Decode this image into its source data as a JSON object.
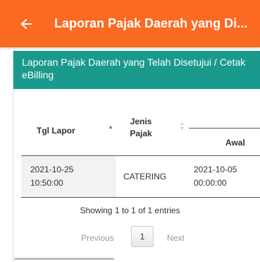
{
  "appbar": {
    "title": "Laporan Pajak Daerah yang Di...",
    "accent": "#fb6a22"
  },
  "card": {
    "header": "Laporan Pajak Daerah yang Telah Disetujui / Cetak eBilling",
    "header_color": "#1a9a8c"
  },
  "table": {
    "columns": {
      "tgl_lapor": "Tgl Lapor",
      "jenis_pajak_line1": "Jenis",
      "jenis_pajak_line2": "Pajak",
      "awal": "Awal"
    },
    "rows": [
      {
        "tgl_lapor_date": "2021-10-25",
        "tgl_lapor_time": "10:50:00",
        "jenis_pajak": "CATERING",
        "awal_date": "2021-10-05",
        "awal_time": "00:00:00"
      }
    ]
  },
  "footer": {
    "info": "Showing 1 to 1 of 1 entries",
    "previous": "Previous",
    "page": "1",
    "next": "Next"
  }
}
